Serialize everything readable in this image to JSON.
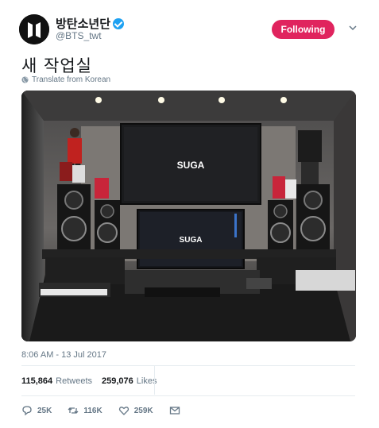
{
  "account": {
    "display_name": "방탄소년단",
    "handle": "@BTS_twt",
    "follow_label": "Following"
  },
  "tweet": {
    "text": "새 작업실",
    "translate_label": "Translate from Korean",
    "timestamp": "8:06 AM - 13 Jul 2017"
  },
  "photo": {
    "monitor_top_label": "SUGA",
    "monitor_bottom_label": "SUGA"
  },
  "stats": {
    "retweets_count": "115,864",
    "retweets_label": "Retweets",
    "likes_count": "259,076",
    "likes_label": "Likes"
  },
  "actions": {
    "reply_count": "25K",
    "retweet_count": "116K",
    "like_count": "259K"
  },
  "colors": {
    "follow_button": "#e0245e",
    "verified": "#1da1f2",
    "muted_text": "#657786"
  }
}
